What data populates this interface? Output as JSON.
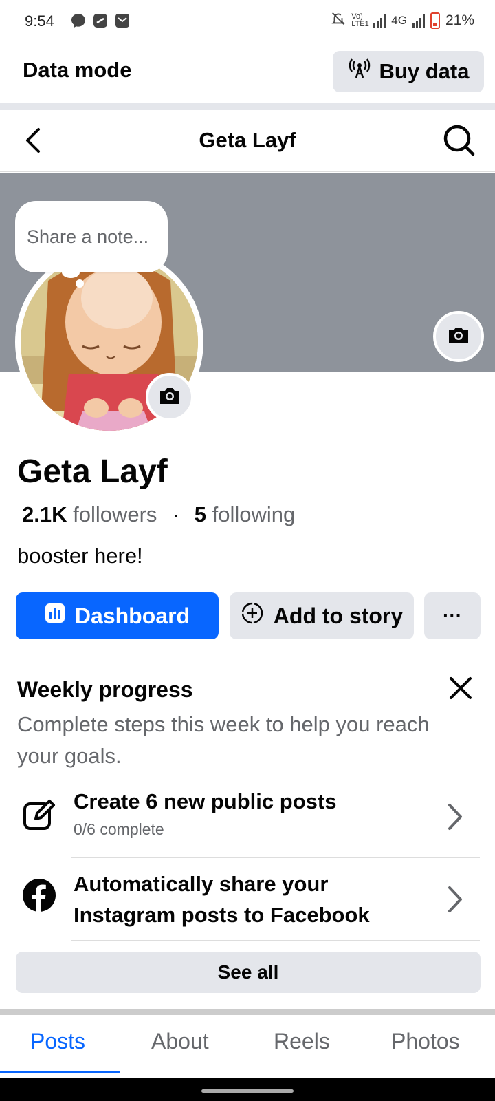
{
  "status_bar": {
    "time": "9:54",
    "network": "4G",
    "volte": "Vo) LTE1",
    "battery": "21%"
  },
  "data_mode": {
    "title": "Data mode",
    "buy_label": "Buy data"
  },
  "nav": {
    "title": "Geta Layf"
  },
  "note": {
    "placeholder": "Share a note..."
  },
  "profile": {
    "name": "Geta Layf",
    "followers_count": "2.1K",
    "followers_label": "followers",
    "following_count": "5",
    "following_label": "following",
    "bio": "booster here!"
  },
  "actions": {
    "dashboard_label": "Dashboard",
    "add_story_label": "Add to story",
    "more_label": "···"
  },
  "weekly_progress": {
    "title": "Weekly progress",
    "description": "Complete steps this week to help you reach your goals.",
    "tasks": [
      {
        "title": "Create 6 new public posts",
        "subtitle": "0/6 complete",
        "icon": "edit-icon"
      },
      {
        "title": "Automatically share your Instagram posts to Facebook",
        "subtitle": "",
        "icon": "facebook-icon"
      }
    ],
    "see_all_label": "See all"
  },
  "tabs": [
    {
      "label": "Posts",
      "active": true
    },
    {
      "label": "About",
      "active": false
    },
    {
      "label": "Reels",
      "active": false
    },
    {
      "label": "Photos",
      "active": false
    }
  ],
  "colors": {
    "accent": "#0866ff",
    "button_grey": "#e4e6eb",
    "cover_grey": "#8e939b",
    "secondary_text": "#65676b"
  }
}
